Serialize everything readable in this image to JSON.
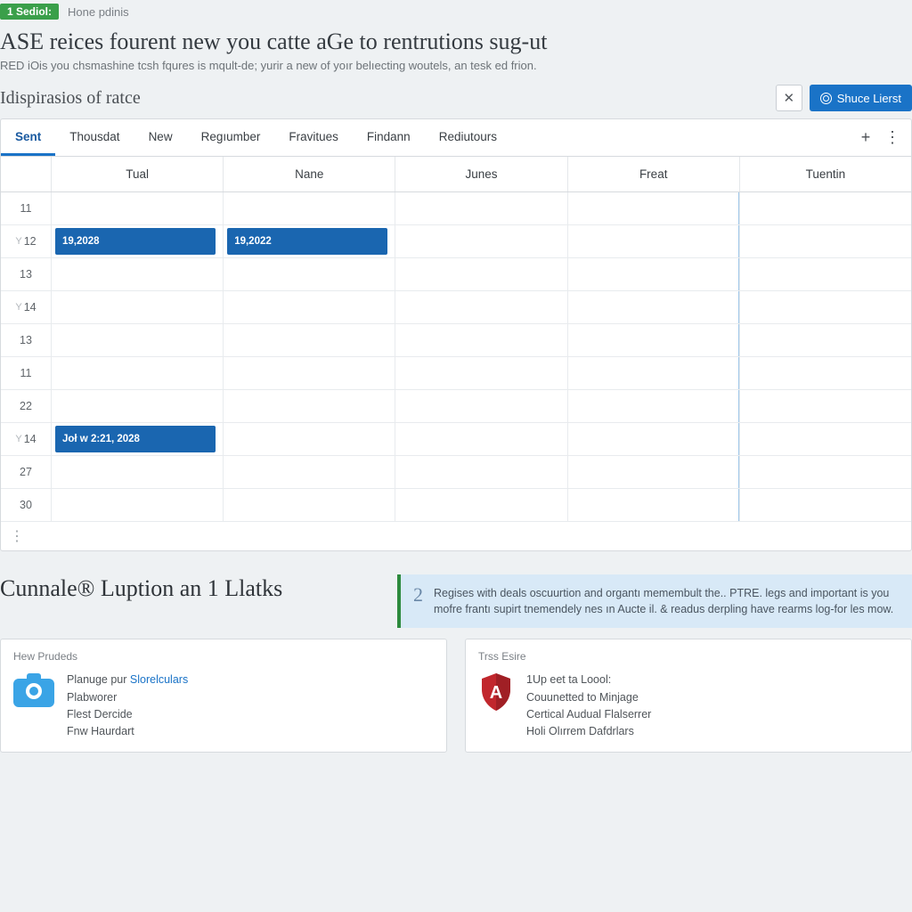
{
  "topbar": {
    "badge": "1 Sediol:",
    "breadcrumb": "Hone pdinis"
  },
  "page": {
    "title": "ASE reices fourent new you catte aGe to rentrutions sug-ut",
    "subtitle": "RED iOis you chsmashine tcsh fqures is mqult-de; yurir a new of yoır belıеcting woutels, an tesk ed frion."
  },
  "module": {
    "title": "Idispirasios of ratce",
    "primary_button": "Shuce Lierst"
  },
  "tabs": {
    "items": [
      {
        "label": "Sent",
        "active": true
      },
      {
        "label": "Thousdat",
        "active": false
      },
      {
        "label": "New",
        "active": false
      },
      {
        "label": "Regıumber",
        "active": false
      },
      {
        "label": "Fravitues",
        "active": false
      },
      {
        "label": "Findann",
        "active": false
      },
      {
        "label": "Rediutours",
        "active": false
      }
    ]
  },
  "calendar": {
    "columns": [
      "Tual",
      "Nane",
      "Junes",
      "Freat",
      "Tuentin"
    ],
    "rows": [
      {
        "num": "11"
      },
      {
        "num": "12",
        "muted": true
      },
      {
        "num": "13"
      },
      {
        "num": "14",
        "muted": true
      },
      {
        "num": "13"
      },
      {
        "num": "11"
      },
      {
        "num": "22"
      },
      {
        "num": "14",
        "muted": true
      },
      {
        "num": "27"
      },
      {
        "num": "30"
      }
    ],
    "events": [
      {
        "row": 1,
        "col": 0,
        "label": "19,2028"
      },
      {
        "row": 1,
        "col": 1,
        "label": "19,2022"
      },
      {
        "row": 7,
        "col": 0,
        "label": "Joł w 2:21, 2028"
      }
    ]
  },
  "bottom": {
    "heading": "Cunnale® Luption an 1 Llatks",
    "info": {
      "num": "2",
      "text": "Regises with deals oscuurtion and organtı memembult the.. PTRE. legs and important is you mofre frantı supirt tnemendely nes ın Aucte il. & readus derpling have rearms log-for les mow."
    },
    "cards": [
      {
        "title": "Hew Prudeds",
        "icon": "camera",
        "lines": [
          "Planuge pur <lnk>Slorelculars</lnk>",
          "Plabworer",
          "Flest Dercide",
          "Fnw Haurdart"
        ]
      },
      {
        "title": "Trss Esire",
        "icon": "shield",
        "lines": [
          "1Up eet ta Loool:",
          "Couunetted to Minjage",
          "Certical Audual Flalserrer",
          "Holi Olırrem Dafdrlars"
        ]
      }
    ]
  }
}
